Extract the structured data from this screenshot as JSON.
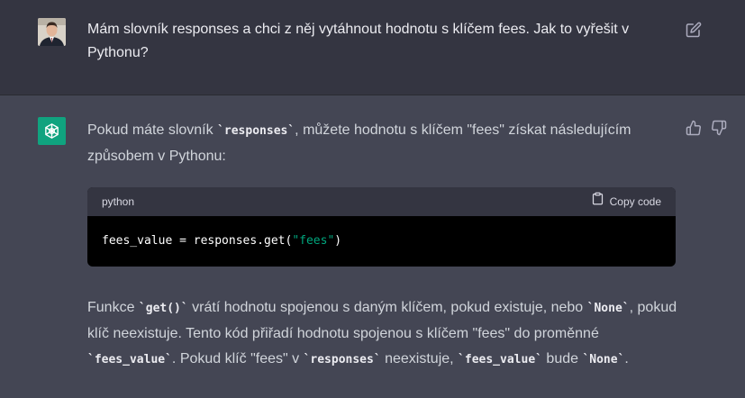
{
  "user_message": {
    "text": "Mám slovník responses a chci z něj vytáhnout hodnotu s klíčem fees. Jak to vyřešit v Pythonu?"
  },
  "assistant_message": {
    "intro_before": "Pokud máte slovník ",
    "intro_code": "`responses`",
    "intro_after": ", můžete hodnotu s klíčem \"fees\" získat následujícím způsobem v Pythonu:",
    "code_block": {
      "language": "python",
      "copy_label": "Copy code",
      "code_prefix": "fees_value = responses.get(",
      "code_string": "\"fees\"",
      "code_suffix": ")"
    },
    "outro": {
      "p1": "Funkce ",
      "c1": "`get()`",
      "p2": " vrátí hodnotu spojenou s daným klíčem, pokud existuje, nebo ",
      "c2": "`None`",
      "p3": ", pokud klíč neexistuje. Tento kód přiřadí hodnotu spojenou s klíčem \"fees\" do proměnné ",
      "c3": "`fees_value`",
      "p4": ". Pokud klíč \"fees\" v ",
      "c4": "`responses`",
      "p5": " neexistuje, ",
      "c5": "`fees_value`",
      "p6": " bude ",
      "c6": "`None`",
      "p7": "."
    }
  },
  "icons": {
    "edit": "edit-icon",
    "thumbs_up": "thumbs-up-icon",
    "thumbs_down": "thumbs-down-icon",
    "clipboard": "clipboard-icon",
    "assistant_logo": "openai-logo-icon"
  },
  "colors": {
    "user_bg": "#343541",
    "assistant_bg": "#444654",
    "accent": "#10a37f",
    "code_string": "#00a67d"
  }
}
